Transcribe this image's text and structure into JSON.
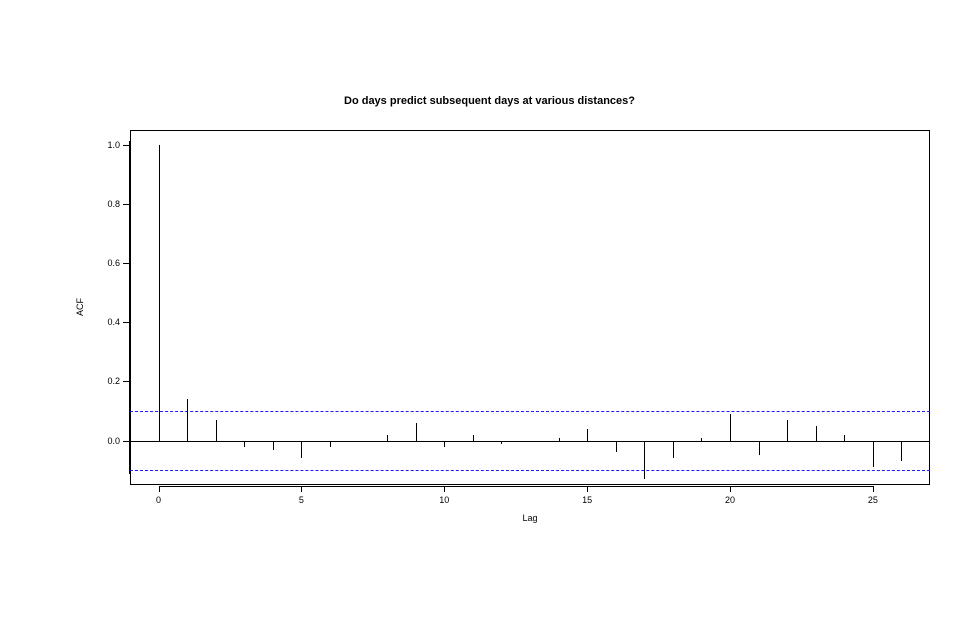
{
  "chart_data": {
    "type": "bar",
    "title": "Do days predict subsequent days at various distances?",
    "xlabel": "Lag",
    "ylabel": "ACF",
    "x_ticks": [
      0,
      5,
      10,
      15,
      20,
      25
    ],
    "y_ticks": [
      0.0,
      0.2,
      0.4,
      0.6,
      0.8,
      1.0
    ],
    "y_tick_labels": [
      "0.0",
      "0.2",
      "0.4",
      "0.6",
      "0.8",
      "1.0"
    ],
    "xlim": [
      -1,
      27
    ],
    "ylim": [
      -0.15,
      1.05
    ],
    "ci": 0.1,
    "x": [
      0,
      1,
      2,
      3,
      4,
      5,
      6,
      7,
      8,
      9,
      10,
      11,
      12,
      13,
      14,
      15,
      16,
      17,
      18,
      19,
      20,
      21,
      22,
      23,
      24,
      25,
      26
    ],
    "values": [
      1.0,
      0.14,
      0.07,
      -0.02,
      -0.03,
      -0.06,
      -0.02,
      0.0,
      0.02,
      0.06,
      -0.02,
      0.02,
      -0.01,
      0.0,
      0.01,
      0.04,
      -0.04,
      -0.13,
      -0.06,
      0.01,
      0.09,
      -0.05,
      0.07,
      0.05,
      0.02,
      -0.09,
      -0.07
    ]
  }
}
